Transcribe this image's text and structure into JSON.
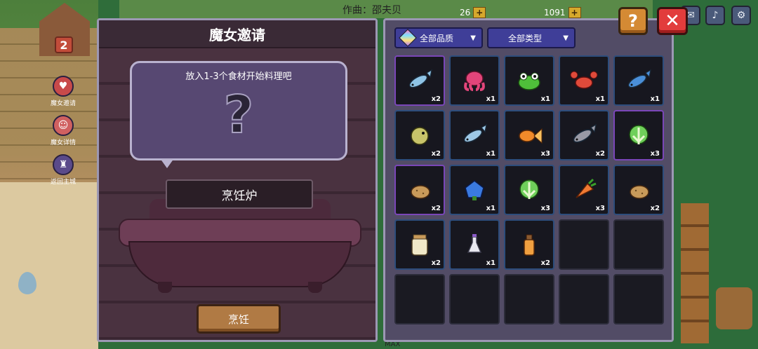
{
  "background": {
    "credit": "作曲：邵夫贝",
    "house_number": "2",
    "currency1": "26",
    "currency2": "1091",
    "max_label": "MAX",
    "side_menu": [
      {
        "label": "魔女邀请",
        "icon": "heart-icon"
      },
      {
        "label": "魔女详情",
        "icon": "witch-icon"
      },
      {
        "label": "返回主城",
        "icon": "castle-icon"
      }
    ]
  },
  "left_panel": {
    "title": "魔女邀请",
    "hint": "放入1-3个食材开始料理吧",
    "placeholder": "?",
    "stove_label": "烹饪炉",
    "cook_button": "烹饪"
  },
  "right_panel": {
    "filter_quality": "全部品质",
    "filter_type": "全部类型",
    "items": [
      {
        "name": "blue-fish",
        "count": "x2",
        "color": "#8fc4e6",
        "shape": "fish",
        "rare": true
      },
      {
        "name": "pink-octopus",
        "count": "x1",
        "color": "#e2457a",
        "shape": "octopus",
        "rare": false
      },
      {
        "name": "green-frog",
        "count": "x1",
        "color": "#4fbf3a",
        "shape": "frog",
        "rare": false
      },
      {
        "name": "red-crab",
        "count": "x1",
        "color": "#e04a3a",
        "shape": "crab",
        "rare": false
      },
      {
        "name": "jumping-fish",
        "count": "x1",
        "color": "#4a8fd8",
        "shape": "fish",
        "rare": false
      },
      {
        "name": "pufferfish",
        "count": "x2",
        "color": "#c8c46a",
        "shape": "puffer",
        "rare": false
      },
      {
        "name": "small-fish",
        "count": "x1",
        "color": "#9ec8e6",
        "shape": "fish",
        "rare": false
      },
      {
        "name": "goldfish",
        "count": "x3",
        "color": "#f08a2a",
        "shape": "goldfish",
        "rare": false
      },
      {
        "name": "grey-fish",
        "count": "x2",
        "color": "#9a9aa6",
        "shape": "fish",
        "rare": false
      },
      {
        "name": "cabbage",
        "count": "x3",
        "color": "#6fcf5a",
        "shape": "cabbage",
        "rare": true
      },
      {
        "name": "potato",
        "count": "x2",
        "color": "#c89a5a",
        "shape": "potato",
        "rare": true
      },
      {
        "name": "blue-flower",
        "count": "x1",
        "color": "#3a7ae0",
        "shape": "flower",
        "rare": false
      },
      {
        "name": "bok-choy",
        "count": "x3",
        "color": "#6fcf5a",
        "shape": "cabbage",
        "rare": false
      },
      {
        "name": "carrot",
        "count": "x3",
        "color": "#f07a32",
        "shape": "carrot",
        "rare": false
      },
      {
        "name": "potato-2",
        "count": "x2",
        "color": "#c89a5a",
        "shape": "potato",
        "rare": false
      },
      {
        "name": "jar",
        "count": "x2",
        "color": "#f0e8c8",
        "shape": "jar",
        "rare": false
      },
      {
        "name": "small-bottle",
        "count": "x1",
        "color": "#e8e8f0",
        "shape": "bottle",
        "rare": false
      },
      {
        "name": "potion",
        "count": "x2",
        "color": "#f0a040",
        "shape": "potion",
        "rare": false
      },
      {
        "name": "empty",
        "count": "",
        "color": "",
        "shape": "",
        "rare": false
      },
      {
        "name": "empty",
        "count": "",
        "color": "",
        "shape": "",
        "rare": false
      },
      {
        "name": "empty",
        "count": "",
        "color": "",
        "shape": "",
        "rare": false
      },
      {
        "name": "empty",
        "count": "",
        "color": "",
        "shape": "",
        "rare": false
      },
      {
        "name": "empty",
        "count": "",
        "color": "",
        "shape": "",
        "rare": false
      },
      {
        "name": "empty",
        "count": "",
        "color": "",
        "shape": "",
        "rare": false
      },
      {
        "name": "empty",
        "count": "",
        "color": "",
        "shape": "",
        "rare": false
      }
    ]
  },
  "buttons": {
    "help": "?",
    "close": "✕"
  },
  "colors": {
    "panel_border": "#9c98b4",
    "filter_blue": "#3f3e98",
    "help_orange": "#d48a34",
    "close_red": "#e23c3c"
  }
}
